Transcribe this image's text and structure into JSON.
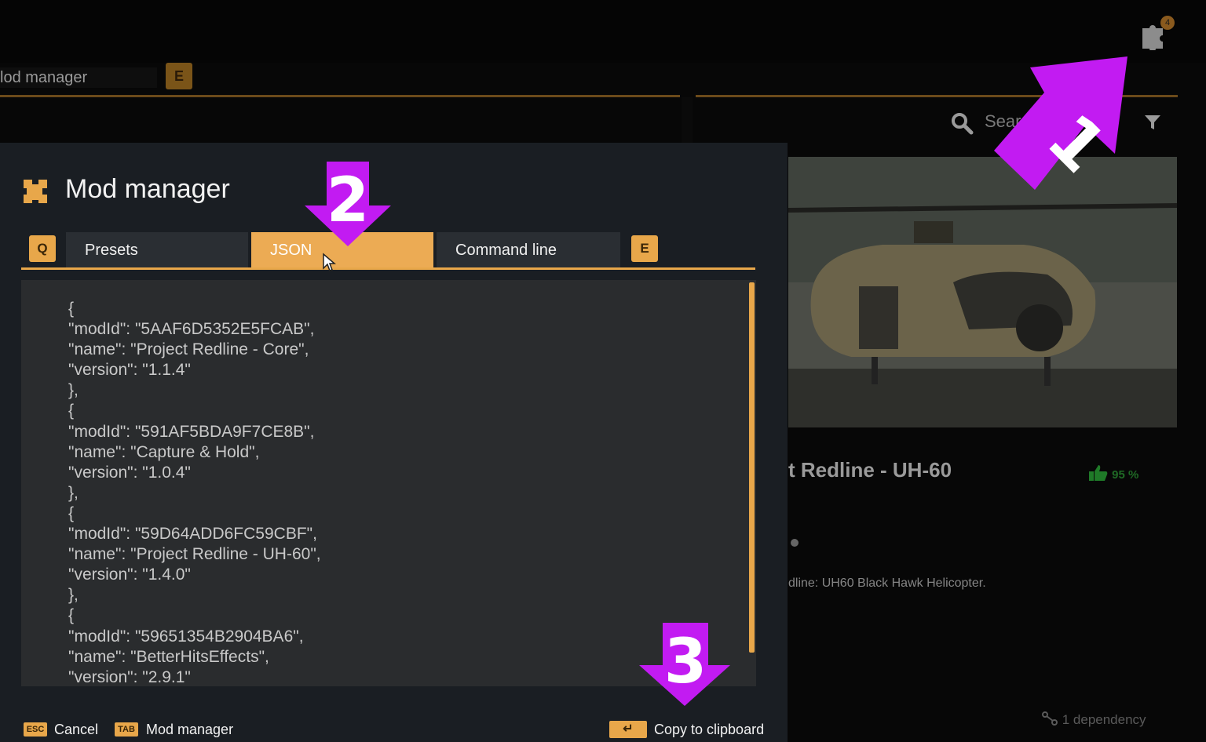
{
  "background": {
    "notification_count": "4",
    "tab_title": "lod manager",
    "tab_key": "E",
    "search_placeholder": "Sear",
    "mod_title": "t Redline - UH-60",
    "rating": "95 %",
    "description": "dline: UH60 Black Hawk Helicopter.",
    "dependency": "1 dependency"
  },
  "modal": {
    "title": "Mod manager",
    "tab_prev_key": "Q",
    "tab_next_key": "E",
    "tabs": [
      {
        "label": "Presets",
        "active": false
      },
      {
        "label": "JSON",
        "active": true
      },
      {
        "label": "Command line",
        "active": false
      }
    ],
    "json_text": "{\n\"modId\": \"5AAF6D5352E5FCAB\",\n\"name\": \"Project Redline - Core\",\n\"version\": \"1.1.4\"\n},\n{\n\"modId\": \"591AF5BDA9F7CE8B\",\n\"name\": \"Capture & Hold\",\n\"version\": \"1.0.4\"\n},\n{\n\"modId\": \"59D64ADD6FC59CBF\",\n\"name\": \"Project Redline - UH-60\",\n\"version\": \"1.4.0\"\n},\n{\n\"modId\": \"59651354B2904BA6\",\n\"name\": \"BetterHitsEffects\",\n\"version\": \"2.9.1\"",
    "footer": {
      "cancel_key": "ESC",
      "cancel_label": "Cancel",
      "tab_key": "TAB",
      "tab_label": "Mod manager",
      "copy_key": "↵",
      "copy_label": "Copy to clipboard"
    }
  },
  "annotations": {
    "step1": "1",
    "step2": "2",
    "step3": "3",
    "color": "#c21bf2"
  },
  "colors": {
    "accent": "#e8a74a",
    "modal_bg": "#1a1e23",
    "json_bg": "#2a2c2e"
  }
}
